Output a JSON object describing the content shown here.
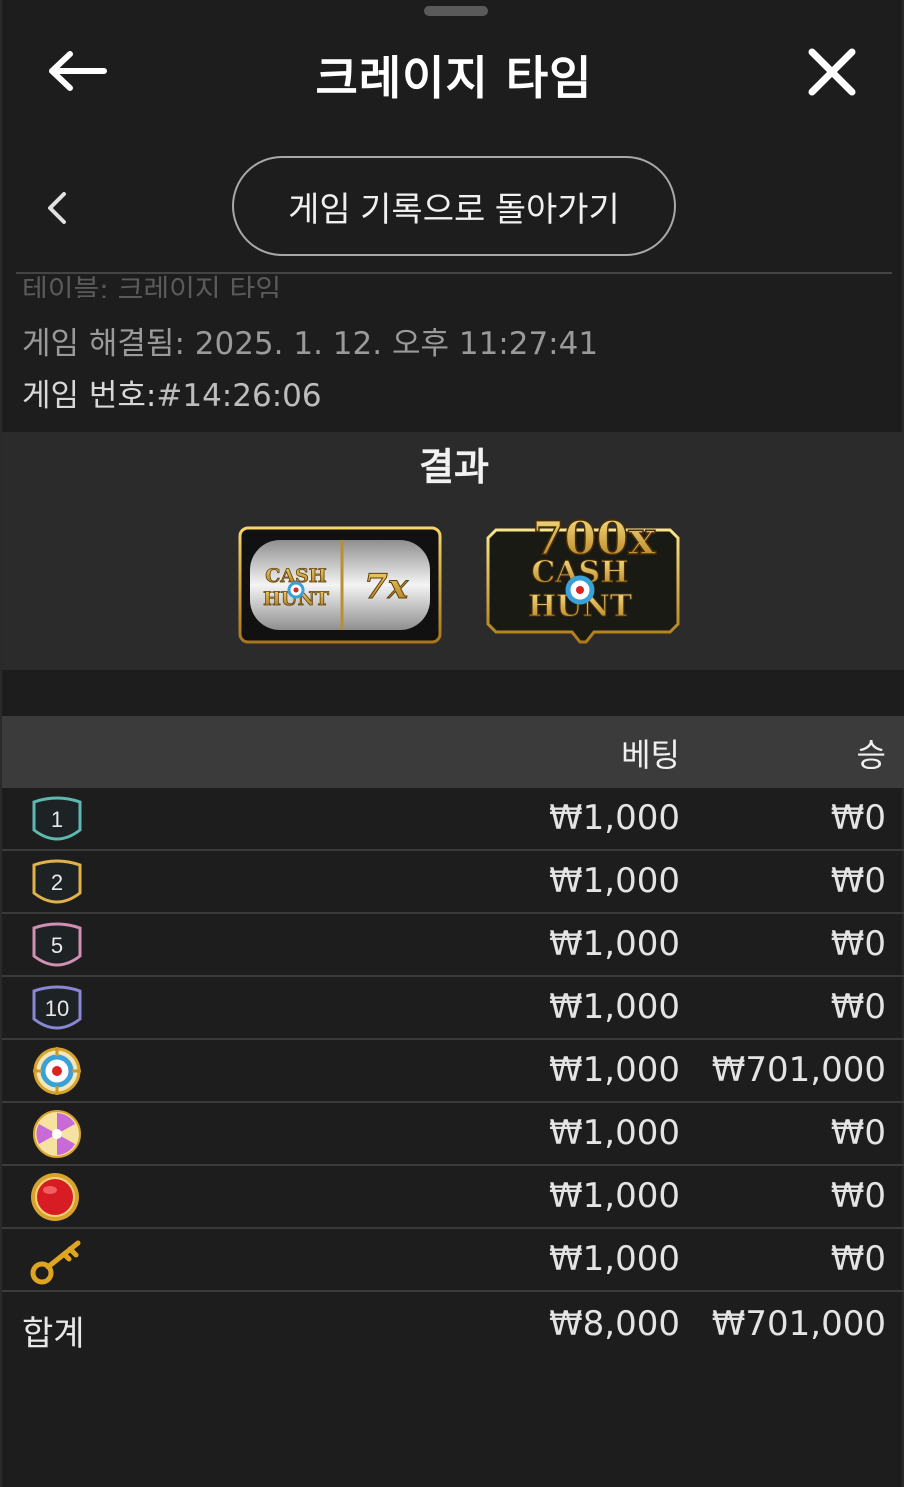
{
  "header": {
    "title": "크레이지 타임"
  },
  "nav": {
    "back_pill_label": "게임 기록으로 돌아가기"
  },
  "info": {
    "table_label": "테이블: 크레이지 타임",
    "resolved_key": "게임 해결됨:",
    "resolved_value": "2025. 1. 12. 오후 11:27:41",
    "game_no_key": "게임 번호:",
    "game_no_value": "#14:26:06"
  },
  "result": {
    "title": "결과",
    "top_slot": {
      "text_a": "CASH",
      "text_b": "HUNT",
      "multiplier": "7x"
    },
    "wheel_result": {
      "multiplier": "700x",
      "text_a": "CASH",
      "text_b": "HUNT"
    }
  },
  "table": {
    "col_bet": "베팅",
    "col_win": "승",
    "rows": [
      {
        "icon": "number-1-badge-icon",
        "label": "1",
        "bet": "₩1,000",
        "win": "₩0",
        "color": "#5fb8b0"
      },
      {
        "icon": "number-2-badge-icon",
        "label": "2",
        "bet": "₩1,000",
        "win": "₩0",
        "color": "#e0b24a"
      },
      {
        "icon": "number-5-badge-icon",
        "label": "5",
        "bet": "₩1,000",
        "win": "₩0",
        "color": "#d18fb4"
      },
      {
        "icon": "number-10-badge-icon",
        "label": "10",
        "bet": "₩1,000",
        "win": "₩0",
        "color": "#8a86d4"
      },
      {
        "icon": "cash-hunt-target-icon",
        "label": "",
        "bet": "₩1,000",
        "win": "₩701,000",
        "color": "#3aa0d8"
      },
      {
        "icon": "pachinko-candy-icon",
        "label": "",
        "bet": "₩1,000",
        "win": "₩0",
        "color": "#c86ad8"
      },
      {
        "icon": "coin-flip-red-icon",
        "label": "",
        "bet": "₩1,000",
        "win": "₩0",
        "color": "#d81c24"
      },
      {
        "icon": "crazy-time-key-icon",
        "label": "",
        "bet": "₩1,000",
        "win": "₩0",
        "color": "#e0a520"
      }
    ],
    "total_label": "합계",
    "total_bet": "₩8,000",
    "total_win": "₩701,000"
  }
}
